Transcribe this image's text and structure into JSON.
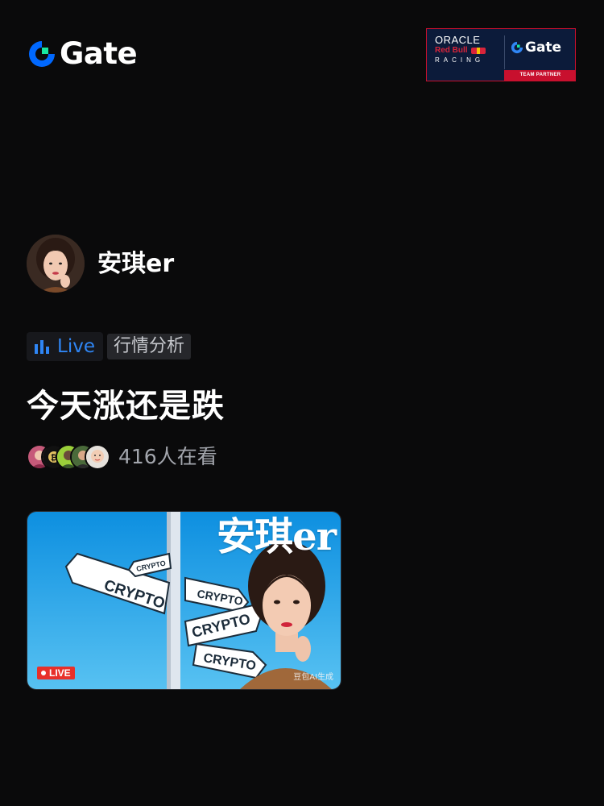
{
  "header": {
    "brand_name": "Gate",
    "brand_color": "#0068ff",
    "accent_color": "#17e6a1",
    "partner_banner": {
      "oracle": "ORACLE",
      "redbull": "Red Bull",
      "racing": "RACING",
      "brand": "Gate",
      "tagline": "TEAM PARTNER"
    }
  },
  "streamer": {
    "name": "安琪er",
    "avatar_icon": "streamer-avatar"
  },
  "tags": {
    "live_label": "Live",
    "live_color": "#2f86f5",
    "topic_label": "行情分析"
  },
  "stream": {
    "title": "今天涨还是跌",
    "viewer_count_text": "416人在看",
    "viewer_avatars": [
      "viewer-1",
      "viewer-2",
      "viewer-3",
      "viewer-4",
      "viewer-5"
    ]
  },
  "thumbnail": {
    "overlay_name": "安琪er",
    "live_badge": "LIVE",
    "ai_note": "豆包AI生成",
    "signs": [
      "CRYPTO",
      "CRYPTO",
      "CRYPTO",
      "CRYPTO",
      "CRYPTO"
    ]
  }
}
